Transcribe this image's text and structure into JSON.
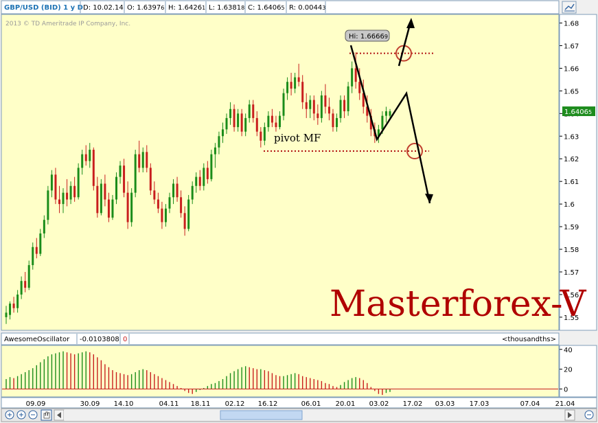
{
  "header": {
    "symbol": "GBP/USD (BID) 1 y D",
    "date": "D: 10.02.14",
    "open": "O: 1.6397",
    "open_sub": "6",
    "high": "H: 1.6426",
    "high_sub": "1",
    "low": "L: 1.6381",
    "low_sub": "8",
    "close": "C: 1.6406",
    "close_sub": "5",
    "range": "R: 0.0044",
    "range_sub": "3"
  },
  "copyright": "2013 © TD Ameritrade IP Company, Inc.",
  "watermark": "Masterforex-V",
  "annotations": {
    "pivot_label": "pivot MF",
    "hi_label": "Hi: 1.6666",
    "hi_sub": "9"
  },
  "last_price": {
    "main": "1.6406",
    "sub": "5"
  },
  "oscillator": {
    "name": "AwesomeOscillator",
    "value": "-0.0103808",
    "value2": "0",
    "units": "<thousandths>"
  },
  "colors": {
    "background": "#ffffc8",
    "up": "#1a8c1a",
    "down": "#c81e1e",
    "border": "#7f9db9",
    "annotation": "#000000",
    "dotted": "#b01010",
    "watermark": "#b00000",
    "price_tag": "#1e8c1e"
  },
  "chart_data": {
    "type": "candlestick",
    "price_axis": {
      "ticks": [
        1.55,
        1.56,
        1.57,
        1.58,
        1.59,
        1.6,
        1.61,
        1.62,
        1.63,
        1.64,
        1.65,
        1.66,
        1.67,
        1.68
      ],
      "tick_labels": [
        "1.55",
        "1.56",
        "1.57",
        "1.58",
        "1.59",
        "1.6",
        "1.61",
        "1.62",
        "1.63",
        "1.64",
        "1.65",
        "1.66",
        "1.67",
        "1.68"
      ],
      "range": [
        1.5442,
        1.6838
      ]
    },
    "osc_axis": {
      "ticks": [
        0,
        20,
        40
      ],
      "tick_labels": [
        "0",
        "20",
        "40"
      ],
      "range": [
        -8,
        44
      ]
    },
    "x_labels": [
      "09.09",
      "30.09",
      "14.10",
      "04.11",
      "18.11",
      "02.12",
      "16.12",
      "06.01",
      "20.01",
      "03.02",
      "17.02",
      "03.03",
      "17.03",
      "07.04",
      "21.04"
    ],
    "candles": [
      [
        1.55,
        1.555,
        1.547,
        1.552
      ],
      [
        1.551,
        1.557,
        1.549,
        1.556
      ],
      [
        1.556,
        1.559,
        1.552,
        1.554
      ],
      [
        1.554,
        1.562,
        1.552,
        1.56
      ],
      [
        1.56,
        1.568,
        1.558,
        1.566
      ],
      [
        1.566,
        1.57,
        1.561,
        1.563
      ],
      [
        1.563,
        1.575,
        1.562,
        1.573
      ],
      [
        1.573,
        1.583,
        1.571,
        1.581
      ],
      [
        1.581,
        1.585,
        1.576,
        1.578
      ],
      [
        1.578,
        1.589,
        1.577,
        1.587
      ],
      [
        1.587,
        1.595,
        1.585,
        1.593
      ],
      [
        1.593,
        1.608,
        1.591,
        1.606
      ],
      [
        1.606,
        1.615,
        1.603,
        1.613
      ],
      [
        1.613,
        1.616,
        1.6,
        1.602
      ],
      [
        1.602,
        1.608,
        1.596,
        1.6
      ],
      [
        1.6,
        1.607,
        1.596,
        1.605
      ],
      [
        1.605,
        1.611,
        1.599,
        1.602
      ],
      [
        1.602,
        1.61,
        1.6,
        1.608
      ],
      [
        1.608,
        1.612,
        1.601,
        1.603
      ],
      [
        1.603,
        1.618,
        1.602,
        1.616
      ],
      [
        1.616,
        1.624,
        1.613,
        1.622
      ],
      [
        1.622,
        1.626,
        1.617,
        1.619
      ],
      [
        1.619,
        1.627,
        1.616,
        1.624
      ],
      [
        1.624,
        1.625,
        1.606,
        1.608
      ],
      [
        1.608,
        1.612,
        1.594,
        1.596
      ],
      [
        1.596,
        1.611,
        1.595,
        1.609
      ],
      [
        1.609,
        1.613,
        1.599,
        1.602
      ],
      [
        1.602,
        1.605,
        1.592,
        1.594
      ],
      [
        1.594,
        1.604,
        1.593,
        1.602
      ],
      [
        1.602,
        1.614,
        1.6,
        1.612
      ],
      [
        1.612,
        1.619,
        1.609,
        1.617
      ],
      [
        1.617,
        1.62,
        1.603,
        1.605
      ],
      [
        1.605,
        1.61,
        1.589,
        1.592
      ],
      [
        1.592,
        1.607,
        1.59,
        1.605
      ],
      [
        1.605,
        1.624,
        1.603,
        1.622
      ],
      [
        1.622,
        1.628,
        1.614,
        1.616
      ],
      [
        1.616,
        1.625,
        1.614,
        1.623
      ],
      [
        1.623,
        1.626,
        1.614,
        1.616
      ],
      [
        1.616,
        1.618,
        1.604,
        1.606
      ],
      [
        1.606,
        1.61,
        1.6,
        1.602
      ],
      [
        1.602,
        1.605,
        1.596,
        1.598
      ],
      [
        1.598,
        1.601,
        1.589,
        1.592
      ],
      [
        1.592,
        1.6,
        1.59,
        1.598
      ],
      [
        1.598,
        1.605,
        1.596,
        1.603
      ],
      [
        1.603,
        1.611,
        1.6,
        1.609
      ],
      [
        1.609,
        1.612,
        1.601,
        1.603
      ],
      [
        1.603,
        1.606,
        1.594,
        1.596
      ],
      [
        1.596,
        1.599,
        1.586,
        1.589
      ],
      [
        1.589,
        1.604,
        1.588,
        1.602
      ],
      [
        1.602,
        1.61,
        1.6,
        1.608
      ],
      [
        1.608,
        1.614,
        1.605,
        1.612
      ],
      [
        1.612,
        1.615,
        1.606,
        1.608
      ],
      [
        1.608,
        1.618,
        1.606,
        1.616
      ],
      [
        1.616,
        1.619,
        1.609,
        1.611
      ],
      [
        1.611,
        1.624,
        1.61,
        1.622
      ],
      [
        1.622,
        1.627,
        1.616,
        1.625
      ],
      [
        1.625,
        1.632,
        1.622,
        1.63
      ],
      [
        1.63,
        1.636,
        1.627,
        1.633
      ],
      [
        1.633,
        1.64,
        1.631,
        1.638
      ],
      [
        1.638,
        1.645,
        1.635,
        1.642
      ],
      [
        1.642,
        1.644,
        1.632,
        1.634
      ],
      [
        1.634,
        1.642,
        1.632,
        1.64
      ],
      [
        1.64,
        1.642,
        1.63,
        1.632
      ],
      [
        1.632,
        1.64,
        1.63,
        1.638
      ],
      [
        1.638,
        1.646,
        1.636,
        1.644
      ],
      [
        1.644,
        1.646,
        1.636,
        1.638
      ],
      [
        1.638,
        1.641,
        1.63,
        1.632
      ],
      [
        1.632,
        1.634,
        1.625,
        1.628
      ],
      [
        1.628,
        1.636,
        1.626,
        1.634
      ],
      [
        1.634,
        1.641,
        1.632,
        1.639
      ],
      [
        1.639,
        1.642,
        1.634,
        1.636
      ],
      [
        1.636,
        1.639,
        1.632,
        1.634
      ],
      [
        1.634,
        1.641,
        1.633,
        1.639
      ],
      [
        1.639,
        1.651,
        1.637,
        1.649
      ],
      [
        1.649,
        1.656,
        1.646,
        1.654
      ],
      [
        1.654,
        1.658,
        1.648,
        1.651
      ],
      [
        1.651,
        1.658,
        1.649,
        1.656
      ],
      [
        1.656,
        1.662,
        1.652,
        1.654
      ],
      [
        1.654,
        1.657,
        1.642,
        1.645
      ],
      [
        1.645,
        1.649,
        1.638,
        1.642
      ],
      [
        1.642,
        1.648,
        1.638,
        1.646
      ],
      [
        1.646,
        1.648,
        1.637,
        1.64
      ],
      [
        1.64,
        1.644,
        1.635,
        1.638
      ],
      [
        1.638,
        1.65,
        1.636,
        1.648
      ],
      [
        1.648,
        1.653,
        1.64,
        1.643
      ],
      [
        1.643,
        1.647,
        1.637,
        1.64
      ],
      [
        1.64,
        1.642,
        1.632,
        1.634
      ],
      [
        1.634,
        1.64,
        1.632,
        1.638
      ],
      [
        1.638,
        1.648,
        1.636,
        1.646
      ],
      [
        1.646,
        1.648,
        1.638,
        1.641
      ],
      [
        1.641,
        1.654,
        1.639,
        1.652
      ],
      [
        1.652,
        1.663,
        1.649,
        1.66
      ],
      [
        1.66,
        1.667,
        1.651,
        1.654
      ],
      [
        1.654,
        1.66,
        1.646,
        1.649
      ],
      [
        1.649,
        1.655,
        1.64,
        1.643
      ],
      [
        1.643,
        1.648,
        1.636,
        1.639
      ],
      [
        1.639,
        1.642,
        1.63,
        1.633
      ],
      [
        1.633,
        1.636,
        1.627,
        1.63
      ],
      [
        1.63,
        1.635,
        1.627,
        1.633
      ],
      [
        1.633,
        1.641,
        1.631,
        1.639
      ],
      [
        1.639,
        1.643,
        1.636,
        1.641
      ],
      [
        1.639,
        1.642,
        1.638,
        1.641
      ]
    ],
    "oscillator_values": [
      10,
      12,
      11,
      13,
      15,
      17,
      19,
      21,
      24,
      27,
      30,
      33,
      35,
      36,
      37,
      38,
      37,
      36,
      35,
      36,
      37,
      38,
      37,
      35,
      32,
      29,
      25,
      22,
      19,
      17,
      16,
      15,
      14,
      15,
      17,
      19,
      20,
      19,
      17,
      15,
      13,
      11,
      9,
      7,
      5,
      3,
      1,
      -2,
      -4,
      -5,
      -3,
      -1,
      1,
      3,
      5,
      6,
      8,
      10,
      13,
      16,
      18,
      20,
      22,
      23,
      22,
      21,
      20,
      20,
      19,
      18,
      16,
      14,
      13,
      13,
      14,
      15,
      16,
      15,
      13,
      12,
      11,
      10,
      9,
      8,
      6,
      5,
      3,
      2,
      4,
      7,
      9,
      11,
      12,
      11,
      9,
      6,
      2,
      -2,
      -5,
      -6,
      -4,
      -3
    ],
    "pivot_level": 1.6234,
    "hi_level": 1.6666
  }
}
